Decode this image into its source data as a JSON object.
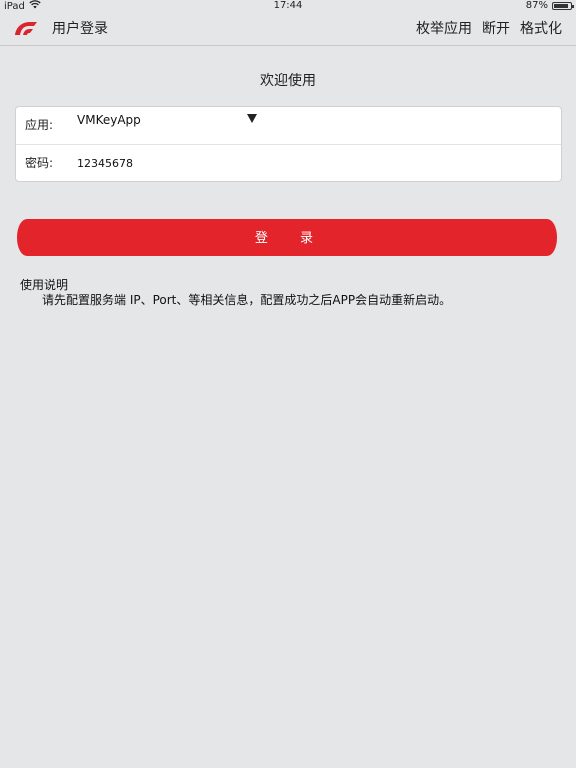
{
  "status_bar": {
    "device": "iPad",
    "time": "17:44",
    "battery": "87%",
    "battery_level": 0.87
  },
  "nav": {
    "title": "用户登录",
    "actions": [
      "枚举应用",
      "断开",
      "格式化"
    ]
  },
  "welcome": "欢迎使用",
  "form": {
    "app_label": "应用:",
    "app_value": "VMKeyApp",
    "password_label": "密码:",
    "password_value": "12345678"
  },
  "login_button": "登 录",
  "instructions": {
    "title": "使用说明",
    "text": "请先配置服务端 IP、Port、等相关信息，配置成功之后APP会自动重新启动。"
  },
  "colors": {
    "accent": "#e3242b",
    "background": "#e5e6e8"
  },
  "icons": {
    "wifi": "wifi-icon",
    "logo": "app-logo-icon",
    "dropdown": "triangle-down-icon"
  }
}
